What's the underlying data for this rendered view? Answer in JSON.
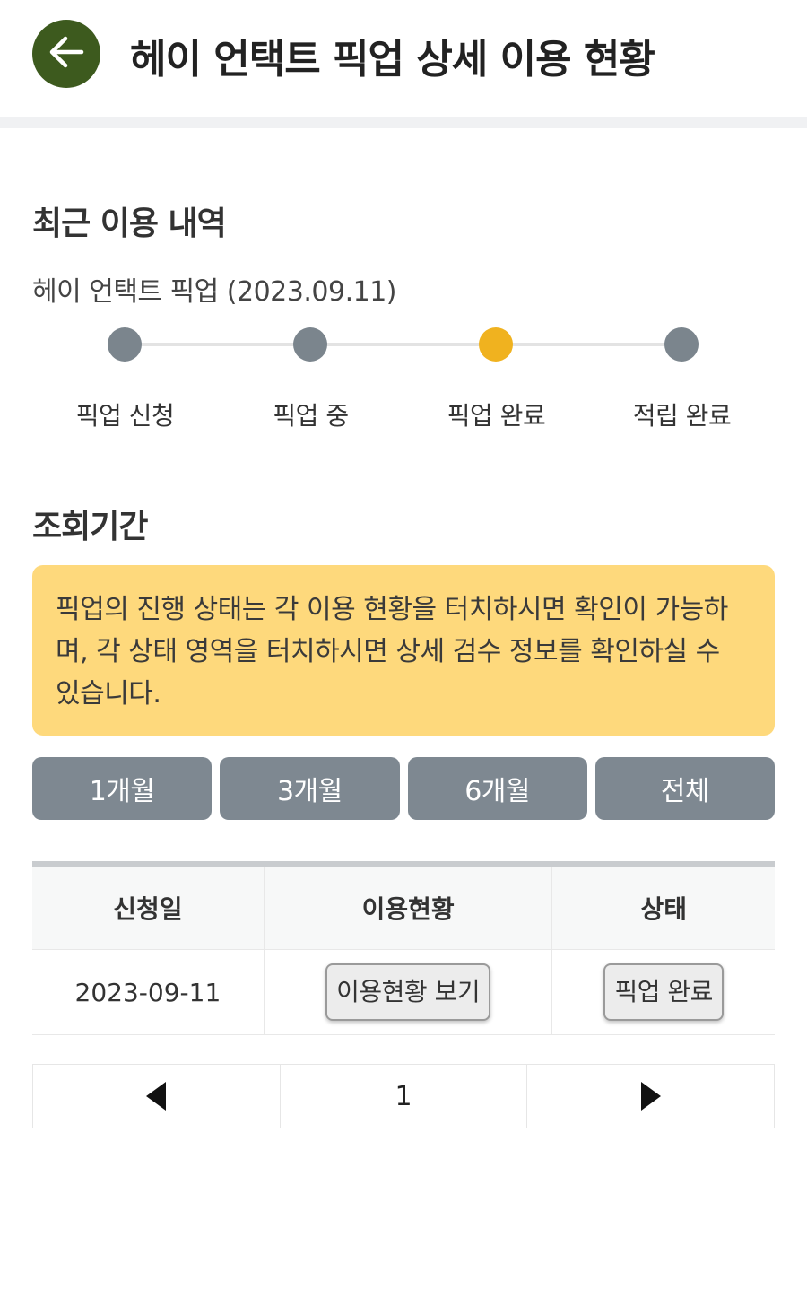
{
  "header": {
    "title": "헤이 언택트 픽업 상세 이용 현황",
    "back_icon": "arrow-left-icon",
    "accent": "#3d5a1e"
  },
  "recent": {
    "title": "최근 이용 내역",
    "subtitle": "헤이 언택트 픽업 (2023.09.11)",
    "steps": [
      {
        "label": "픽업 신청",
        "active": false
      },
      {
        "label": "픽업 중",
        "active": false
      },
      {
        "label": "픽업 완료",
        "active": true
      },
      {
        "label": "적립 완료",
        "active": false
      }
    ],
    "active_color": "#f0b21f",
    "inactive_color": "#7b858d"
  },
  "period": {
    "title": "조회기간",
    "notice": "픽업의 진행 상태는 각 이용 현황을 터치하시면 확인이 가능하며, 각 상태 영역을 터치하시면 상세 검수 정보를 확인하실 수 있습니다.",
    "buttons": [
      "1개월",
      "3개월",
      "6개월",
      "전체"
    ]
  },
  "table": {
    "headers": [
      "신청일",
      "이용현황",
      "상태"
    ],
    "rows": [
      {
        "date": "2023-09-11",
        "usage_button": "이용현황 보기",
        "status_button": "픽업 완료"
      }
    ]
  },
  "pager": {
    "current_page": "1",
    "prev_icon": "triangle-left-icon",
    "next_icon": "triangle-right-icon"
  }
}
